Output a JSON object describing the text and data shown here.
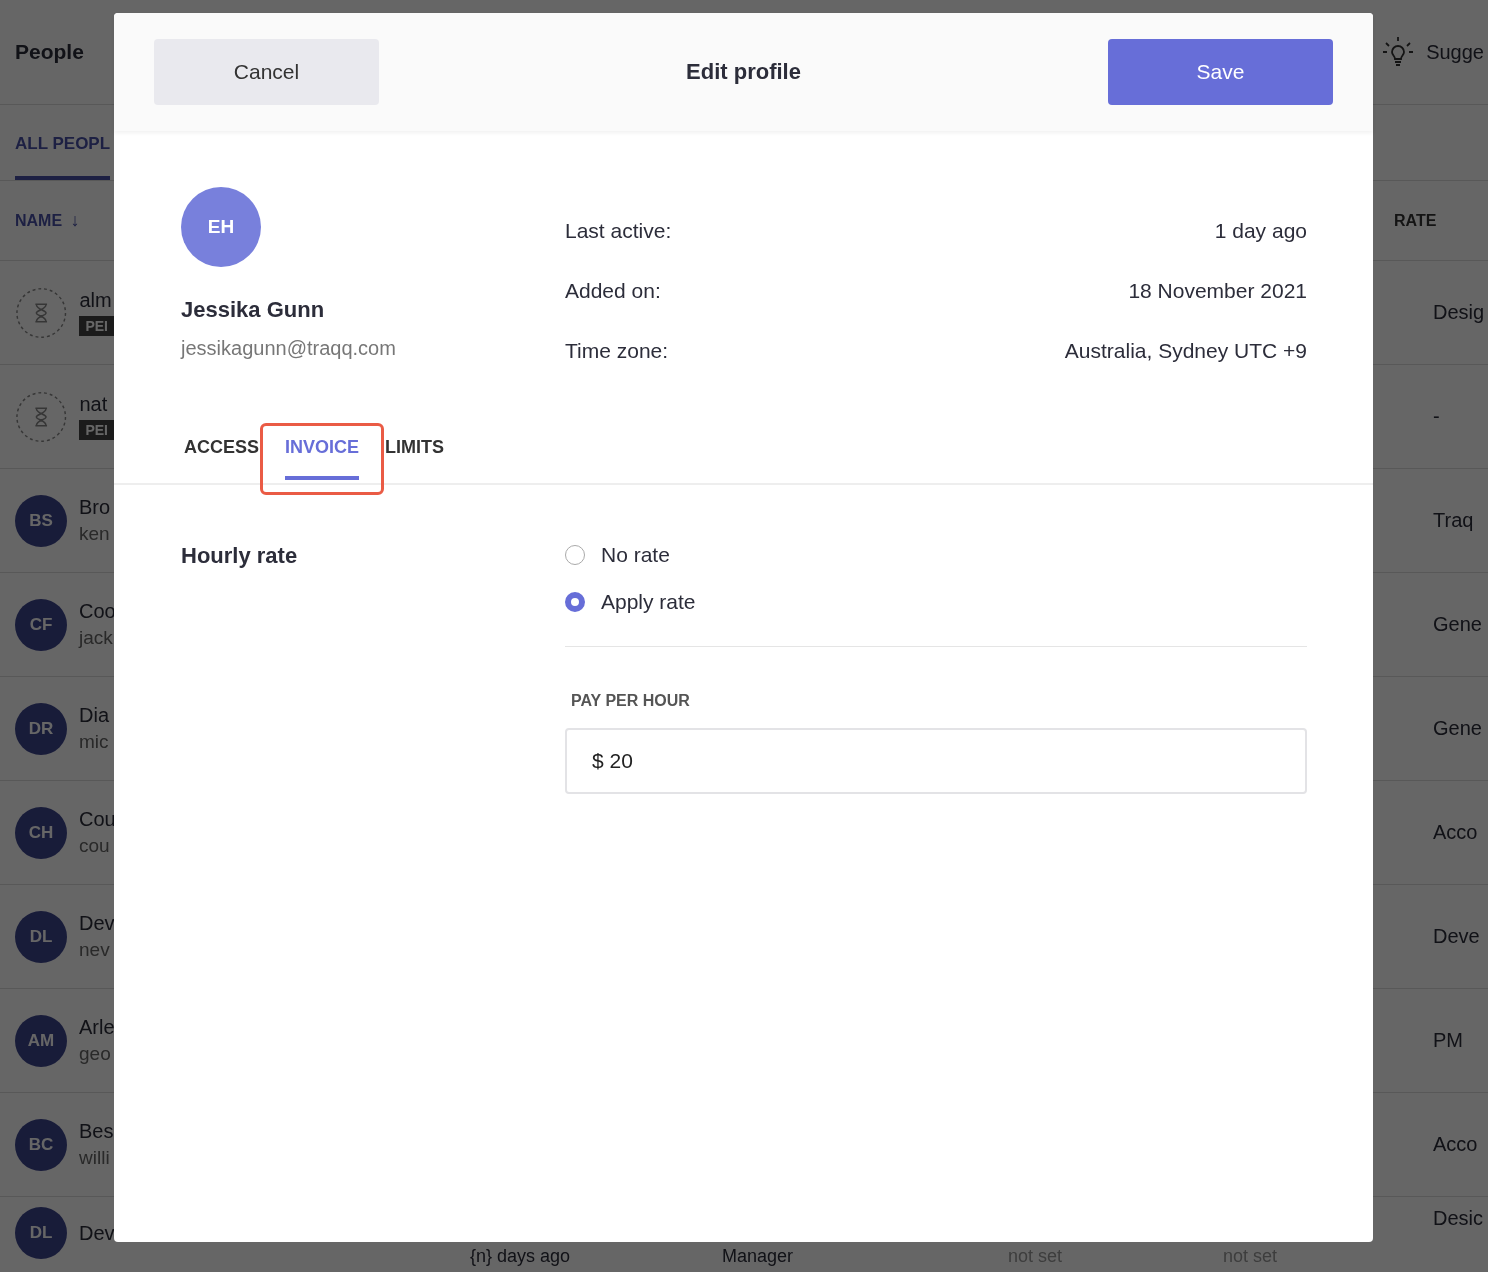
{
  "background": {
    "title": "People",
    "suggest": "Sugge",
    "tab": "ALL PEOPL",
    "name_header": "NAME",
    "sort_arrow": "↓",
    "rate_header": "RATE",
    "rows": [
      {
        "kind": "pending",
        "initials": "",
        "name": "alm",
        "badge": "PEI",
        "column_5": "Desig"
      },
      {
        "kind": "pending",
        "initials": "",
        "name": "nat",
        "badge": "PEI",
        "column_5": "-"
      },
      {
        "kind": "member",
        "initials": "BS",
        "name": "Bro",
        "email": "ken",
        "column_5": "Traq"
      },
      {
        "kind": "member",
        "initials": "CF",
        "name": "Coo",
        "email": "jack",
        "column_5": "Gene"
      },
      {
        "kind": "member",
        "initials": "DR",
        "name": "Dia",
        "email": "mic",
        "column_5": "Gene"
      },
      {
        "kind": "member",
        "initials": "CH",
        "name": "Cou",
        "email": "cou",
        "column_5": "Acco"
      },
      {
        "kind": "member",
        "initials": "DL",
        "name": "Dev",
        "email": "nev",
        "column_5": "Deve"
      },
      {
        "kind": "member",
        "initials": "AM",
        "name": "Arle",
        "email": "geo",
        "column_5": "PM"
      },
      {
        "kind": "member",
        "initials": "BC",
        "name": "Bes",
        "email": "willi",
        "column_5": "Acco"
      },
      {
        "kind": "member",
        "initials": "DL",
        "name": "Dev",
        "email": "",
        "last_active": "{n} days ago",
        "role": "Manager",
        "column_3": "not set",
        "column_4": "not set",
        "column_5": "Desic"
      }
    ]
  },
  "modal": {
    "cancel": "Cancel",
    "title": "Edit profile",
    "save": "Save",
    "profile": {
      "initials": "EH",
      "name": "Jessika Gunn",
      "email": "jessikagunn@traqq.com",
      "details": [
        {
          "label": "Last active:",
          "value": "1 day ago"
        },
        {
          "label": "Added on:",
          "value": "18 November 2021"
        },
        {
          "label": "Time zone:",
          "value": "Australia, Sydney UTC +9"
        }
      ]
    },
    "tabs": [
      {
        "label": "ACCESS",
        "selected": false,
        "highlighted": false
      },
      {
        "label": "INVOICE",
        "selected": true,
        "highlighted": true
      },
      {
        "label": "LIMITS",
        "selected": false,
        "highlighted": false
      }
    ],
    "section_title": "Hourly rate",
    "options": [
      {
        "label": "No rate",
        "selected": false
      },
      {
        "label": "Apply rate",
        "selected": true
      }
    ],
    "pay_label": "PAY PER HOUR",
    "pay_value": "$ 20"
  }
}
